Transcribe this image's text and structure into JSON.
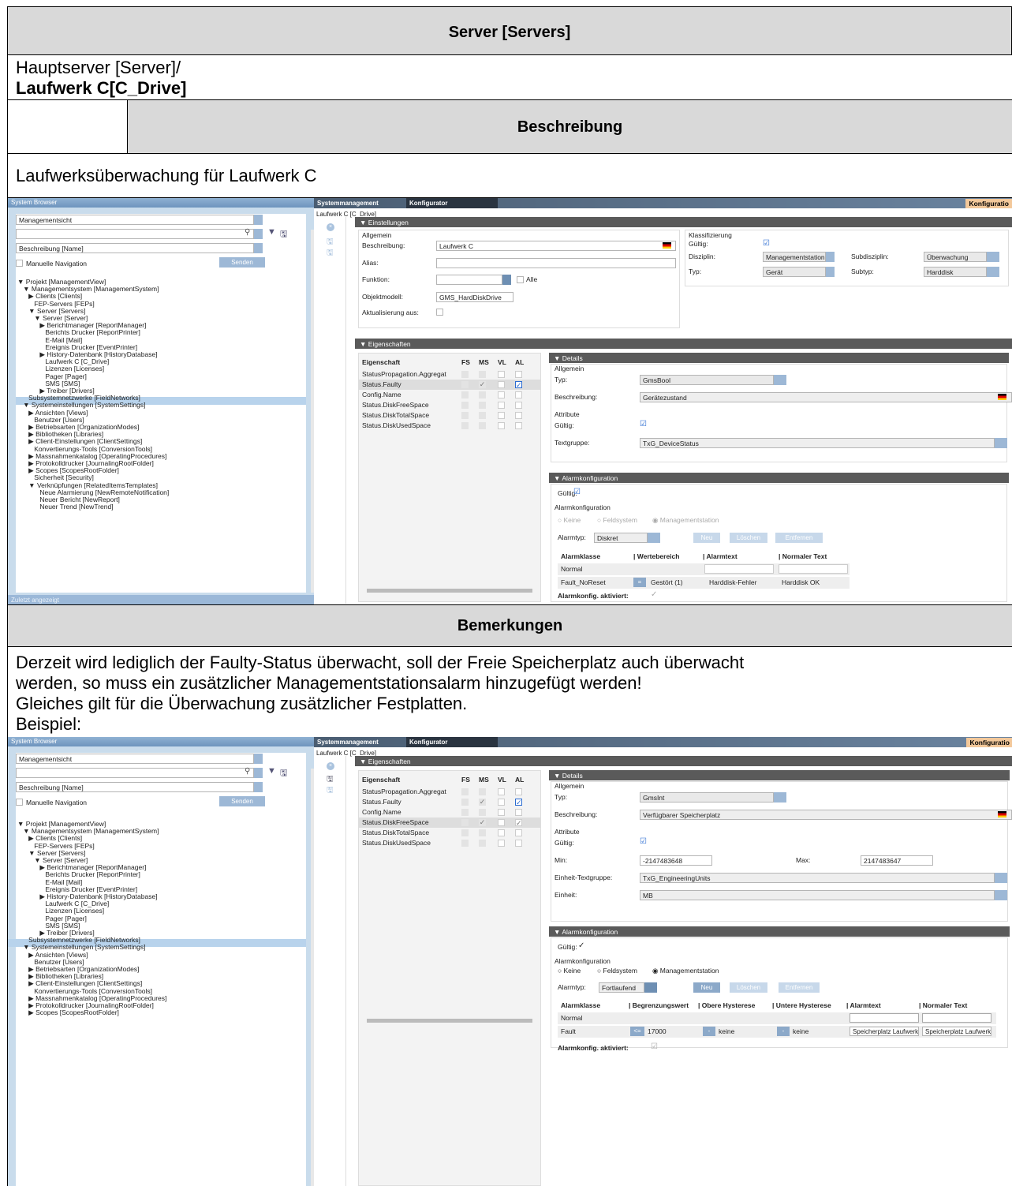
{
  "doc": {
    "title": "Server [Servers]",
    "path_line1": "Hauptserver [Server]/",
    "path_line2": "Laufwerk C[C_Drive]",
    "desc_header": "Beschreibung",
    "desc_text": "Laufwerksüberwachung für Laufwerk C",
    "remarks_header": "Bemerkungen",
    "remarks_line1": "Derzeit wird lediglich der Faulty-Status überwacht, soll der Freie Speicherplatz auch überwacht",
    "remarks_line2": "werden, so muss ein zusätzlicher Managementstationsalarm hinzugefügt werden!",
    "remarks_line3": "Gleiches gilt für die Überwachung zusätzlicher Festplatten.",
    "remarks_line4": "Beispiel:"
  },
  "app": {
    "system_browser": "System Browser",
    "tab_sysmgmt": "Systemmanagement",
    "tab_konf": "Konfigurator",
    "konf_badge": "Konfiguratio",
    "view_select": "Managementsicht",
    "sort_select": "Beschreibung [Name]",
    "manual_nav": "Manuelle Navigation",
    "send": "Senden",
    "recent": "Zuletzt angezeigt",
    "breadcrumb": "Laufwerk C [C_Drive]",
    "tree": [
      "▼ Projekt [ManagementView]",
      "   ▼ Managementsystem [ManagementSystem]",
      "      ▶ Clients [Clients]",
      "         FEP-Servers [FEPs]",
      "      ▼ Server [Servers]",
      "         ▼ Server [Server]",
      "            ▶ Berichtmanager [ReportManager]",
      "               Berichts Drucker [ReportPrinter]",
      "               E-Mail [Mail]",
      "               Ereignis Drucker [EventPrinter]",
      "            ▶ History-Datenbank [HistoryDatabase]",
      "               Laufwerk C [C_Drive]",
      "               Lizenzen [Licenses]",
      "               Pager [Pager]",
      "               SMS [SMS]",
      "            ▶ Treiber [Drivers]",
      "      Subsystemnetzwerke [FieldNetworks]",
      "   ▼ Systemeinstellungen [SystemSettings]",
      "      ▶ Ansichten [Views]",
      "         Benutzer [Users]",
      "      ▶ Betriebsarten [OrganizationModes]",
      "      ▶ Bibliotheken [Libraries]",
      "      ▶ Client-Einstellungen [ClientSettings]",
      "         Konvertierungs-Tools [ConversionTools]",
      "      ▶ Massnahmenkatalog [OperatingProcedures]",
      "      ▶ Protokolldrucker [JournalingRootFolder]",
      "      ▶ Scopes [ScopesRootFolder]",
      "         Sicherheit [Security]",
      "      ▼ Verknüpfungen [RelatedItemsTemplates]",
      "            Neue Alarmierung [NewRemoteNotification]",
      "            Neuer Bericht [NewReport]",
      "            Neuer Trend [NewTrend]"
    ],
    "einstellungen": "Einstellungen",
    "allgemein": "Allgemein",
    "beschreibung_lbl": "Beschreibung:",
    "beschreibung_val": "Laufwerk C",
    "alias_lbl": "Alias:",
    "funktion_lbl": "Funktion:",
    "alle": "Alle",
    "objektmodell_lbl": "Objektmodell:",
    "objektmodell_val": "GMS_HardDiskDrive",
    "aktualisierung_lbl": "Aktualisierung aus:",
    "klassifizierung": "Klassifizierung",
    "gueltig_lbl": "Gültig:",
    "disziplin_lbl": "Disziplin:",
    "disziplin_val": "Managementstation",
    "subdisziplin_lbl": "Subdisziplin:",
    "subdisziplin_val": "Überwachung",
    "typ_lbl": "Typ:",
    "typ_val": "Gerät",
    "subtyp_lbl": "Subtyp:",
    "subtyp_val": "Harddisk",
    "eigenschaften": "Eigenschaften",
    "col_eig": "Eigenschaft",
    "col_fs": "FS",
    "col_ms": "MS",
    "col_vl": "VL",
    "col_al": "AL",
    "props": [
      "StatusPropagation.Aggregat",
      "Status.Faulty",
      "Config.Name",
      "Status.DiskFreeSpace",
      "Status.DiskTotalSpace",
      "Status.DiskUsedSpace"
    ],
    "details": "Details",
    "attribute": "Attribute",
    "beschreibung2_lbl": "Beschreibung:",
    "textgruppe_lbl": "Textgruppe:",
    "alarmkonfiguration": "Alarmkonfiguration",
    "keine": "Keine",
    "feldsystem": "Feldsystem",
    "managementstation": "Managementstation",
    "alarmtyp_lbl": "Alarmtyp:",
    "neu": "Neu",
    "loeschen": "Löschen",
    "entfernen": "Entfernen",
    "alarmklasse": "Alarmklasse",
    "alarmtext": "Alarmtext",
    "normaler_text": "Normaler Text",
    "normal": "Normal",
    "aktiviert_lbl": "Alarmkonfig. aktiviert:",
    "shot1": {
      "typ_val": "GmsBool",
      "beschreibung_val": "Gerätezustand",
      "textgruppe_val": "TxG_DeviceStatus",
      "alarmtyp_val": "Diskret",
      "col_wert": "Wertebereich",
      "r2_klasse": "Fault_NoReset",
      "r2_op": "=",
      "r2_wert": "Gestört (1)",
      "r2_alarm": "Harddisk-Fehler",
      "r2_normal": "Harddisk OK"
    },
    "shot2": {
      "typ_val": "GmsInt",
      "beschreibung_val": "Verfügbarer Speicherplatz",
      "min_lbl": "Min:",
      "min_val": "-2147483648",
      "max_lbl": "Max:",
      "max_val": "2147483647",
      "eh_tg_lbl": "Einheit-Textgruppe:",
      "eh_tg_val": "TxG_EngineeringUnits",
      "eh_lbl": "Einheit:",
      "eh_val": "MB",
      "alarmtyp_val": "Fortlaufend",
      "col_grenz": "Begrenzungswert",
      "col_ohyst": "Obere Hysterese",
      "col_uhyst": "Untere Hysterese",
      "r2_klasse": "Fault",
      "r2_op": "<=",
      "r2_wert": "17000",
      "r2_h1": "keine",
      "r2_h2": "keine",
      "r2_alarm": "Speicherplatz Laufwerk",
      "r2_normal": "Speicherplatz Laufwerk",
      "minus": "-"
    }
  },
  "colors": {
    "accent": "#6e94bd",
    "tabs": "#3b4a5a",
    "konf": "#f3c89a",
    "header_gray": "#d9d9d9"
  }
}
